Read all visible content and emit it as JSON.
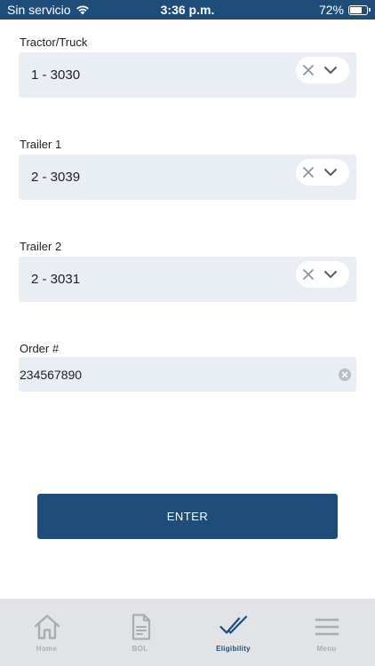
{
  "status_bar": {
    "carrier": "Sin servicio",
    "time": "3:36 p.m.",
    "battery": "72%",
    "battery_level": 0.72
  },
  "form": {
    "tractor": {
      "label": "Tractor/Truck",
      "value": "1 - 3030"
    },
    "trailer1": {
      "label": "Trailer 1",
      "value": "2 - 3039"
    },
    "trailer2": {
      "label": "Trailer 2",
      "value": "2 - 3031"
    },
    "order": {
      "label": "Order #",
      "value": "234567890"
    }
  },
  "enter_label": "ENTER",
  "tabs": [
    {
      "label": "Home",
      "icon": "home-icon",
      "active": false
    },
    {
      "label": "BOL",
      "icon": "document-icon",
      "active": false
    },
    {
      "label": "Eligibility",
      "icon": "double-check-icon",
      "active": true
    },
    {
      "label": "Menu",
      "icon": "hamburger-menu-icon",
      "active": false
    }
  ],
  "colors": {
    "primary": "#1f4d79",
    "field_bg": "#e8eef3",
    "tab_bar_bg": "#e1e3e6",
    "tab_inactive": "#a9adb2"
  }
}
